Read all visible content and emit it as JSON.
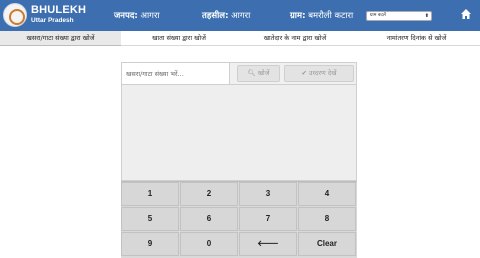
{
  "header": {
    "brand_title": "BHULEKH",
    "brand_subtitle": "Uttar Pradesh",
    "district_label": "जनपद:",
    "district_value": "आगरा",
    "tehsil_label": "तहसील:",
    "tehsil_value": "आगरा",
    "village_label": "ग्राम:",
    "village_value": "बमरौली कटारा",
    "village_select": "ग्राम बदलें",
    "home_icon": "home-icon"
  },
  "tabs": [
    {
      "label": "खसरा/गाटा संख्या द्वारा खोजें",
      "active": true
    },
    {
      "label": "खाता संख्या द्वारा खोजें",
      "active": false
    },
    {
      "label": "खातेदार के नाम द्वारा खोजें",
      "active": false
    },
    {
      "label": "नामांतरण दिनांक से खोजें",
      "active": false
    }
  ],
  "search": {
    "placeholder": "खसरा/गाटा संख्या भरें...",
    "search_button": "खोजें",
    "search_icon": "search-icon",
    "view_button": "उध्दरण देखें",
    "view_icon": "check-icon"
  },
  "keypad": {
    "keys": [
      "1",
      "2",
      "3",
      "4",
      "5",
      "6",
      "7",
      "8",
      "9",
      "0",
      "🡐",
      "Clear"
    ]
  },
  "colors": {
    "header_bg": "#3d6fb0",
    "active_tab_bg": "#e9e9e9",
    "keypad_bg": "#d7d7d7"
  }
}
